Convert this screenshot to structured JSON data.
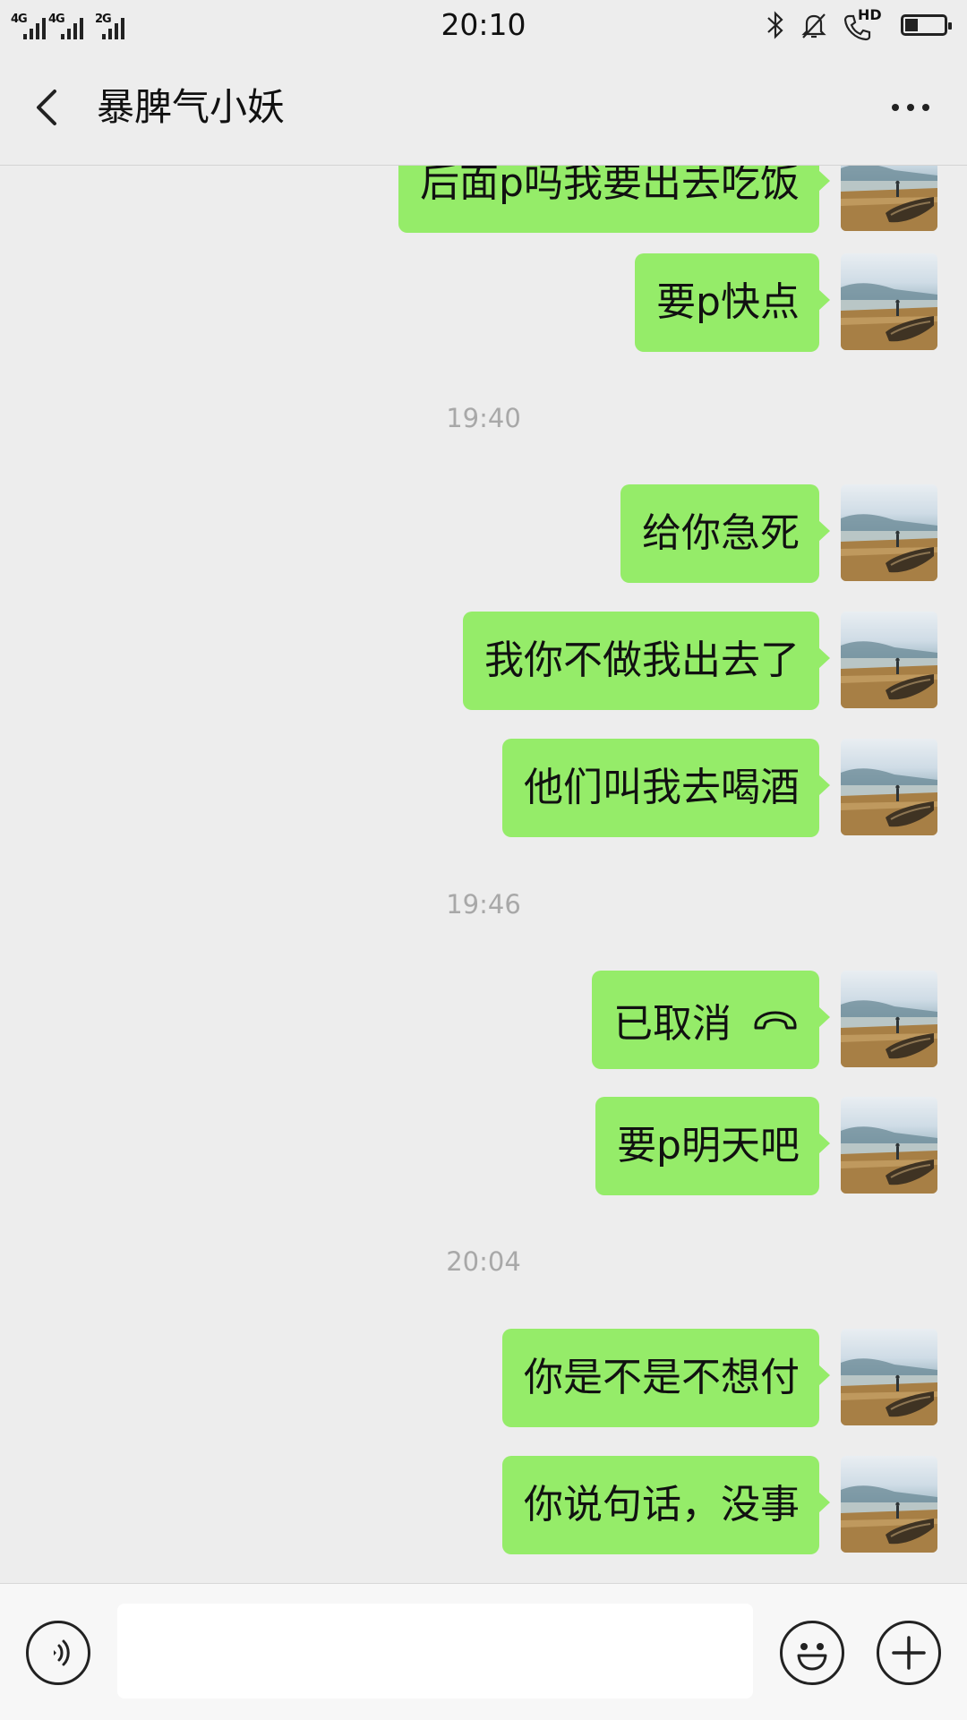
{
  "status_bar": {
    "time": "20:10",
    "signals": [
      "4G",
      "4G",
      "2G"
    ],
    "hd_label": "HD",
    "battery_level": 0.3
  },
  "header": {
    "title": "暴脾气小妖",
    "back_icon": "chevron-left-icon",
    "more_icon": "more-dots-icon"
  },
  "messages": [
    {
      "text": "后面p吗我要出去吃饭"
    },
    {
      "text": "要p快点"
    },
    {
      "text": "给你急死"
    },
    {
      "text": "我你不做我出去了"
    },
    {
      "text": "他们叫我去喝酒"
    },
    {
      "text": "已取消",
      "icon": "hangup-phone-icon"
    },
    {
      "text": "要p明天吧"
    },
    {
      "text": "你是不是不想付"
    },
    {
      "text": "你说句话，没事"
    }
  ],
  "timestamps": [
    "19:40",
    "19:46",
    "20:04"
  ],
  "bottom_bar": {
    "input_value": "",
    "voice_icon": "voice-icon",
    "emoji_icon": "emoji-icon",
    "plus_icon": "plus-icon"
  },
  "colors": {
    "background": "#ededed",
    "bubble": "#95ec69",
    "timestamp_text": "#a8a8a8"
  }
}
